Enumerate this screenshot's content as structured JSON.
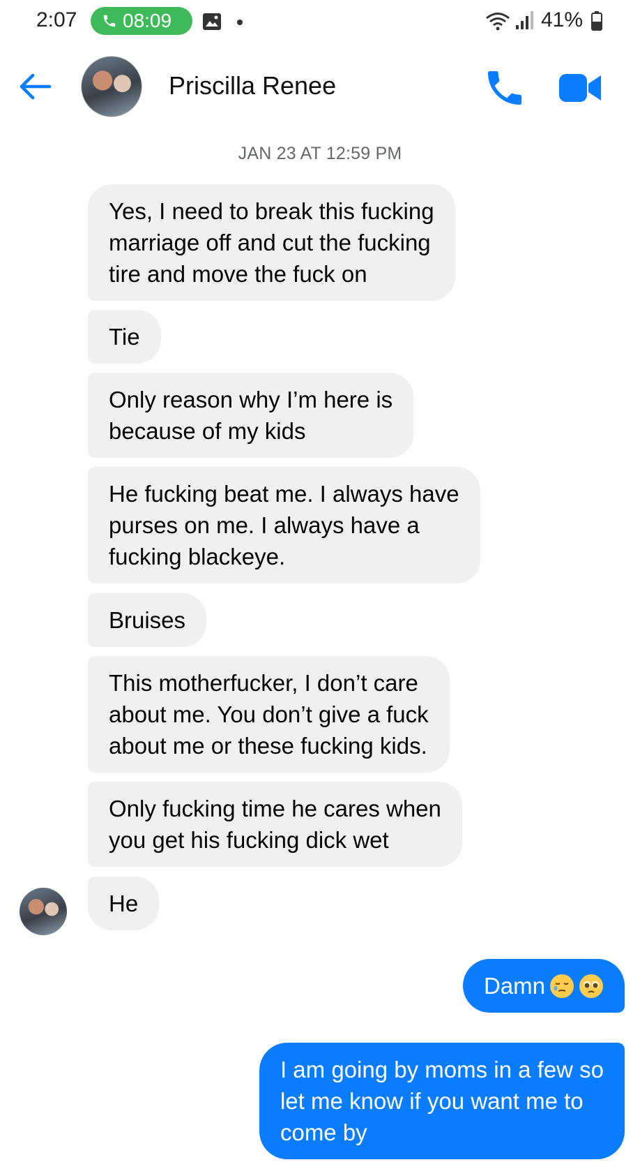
{
  "status_bar": {
    "time": "2:07",
    "call_duration": "08:09",
    "battery": "41%"
  },
  "header": {
    "contact_name": "Priscilla Renee"
  },
  "thread": {
    "timestamp": "JAN 23 AT 12:59 PM",
    "incoming": [
      "Yes, I need to break this fucking\nmarriage off and cut the fucking\ntire and move the fuck on",
      "Tie",
      "Only reason why I’m here is\nbecause of my kids",
      "He fucking beat me. I always have\npurses on me. I always have a\nfucking blackeye.",
      "Bruises",
      "This motherfucker, I don’t care\nabout me. You don’t give a fuck\nabout me or these fucking kids.",
      "Only fucking time he cares when\nyou get his fucking dick wet",
      "He"
    ],
    "outgoing": [
      "Damn",
      "I am going by moms in a few so\nlet me know if you want me to\ncome by"
    ],
    "outgoing_emojis": [
      "sleepy-face-emoji",
      "pleading-face-emoji"
    ]
  },
  "colors": {
    "accent": "#0a7cff",
    "incoming_bubble": "#f0f0f0",
    "call_pill": "#3fba5a"
  }
}
